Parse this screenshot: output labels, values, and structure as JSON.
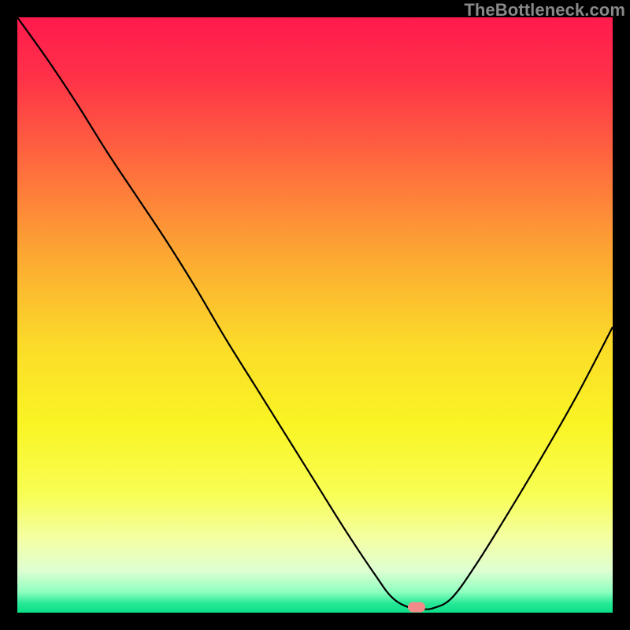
{
  "watermark": "TheBottleneck.com",
  "marker": {
    "color": "#F48A8A",
    "x_pct": 67.0,
    "y_pct": 99.1
  },
  "chart_data": {
    "type": "line",
    "title": "",
    "xlabel": "",
    "ylabel": "",
    "xlim": [
      0,
      100
    ],
    "ylim": [
      0,
      100
    ],
    "gradient_stops": [
      {
        "offset": 0.0,
        "color": "#FF1A4E"
      },
      {
        "offset": 0.1,
        "color": "#FF3148"
      },
      {
        "offset": 0.25,
        "color": "#FE6C3D"
      },
      {
        "offset": 0.4,
        "color": "#FCA832"
      },
      {
        "offset": 0.55,
        "color": "#FBDB29"
      },
      {
        "offset": 0.68,
        "color": "#FAF424"
      },
      {
        "offset": 0.8,
        "color": "#F8FE53"
      },
      {
        "offset": 0.88,
        "color": "#F3FFA8"
      },
      {
        "offset": 0.93,
        "color": "#DDFFD2"
      },
      {
        "offset": 0.965,
        "color": "#8FFFC0"
      },
      {
        "offset": 0.985,
        "color": "#25E895"
      },
      {
        "offset": 1.0,
        "color": "#0BDF87"
      }
    ],
    "series": [
      {
        "name": "bottleneck-curve",
        "color": "#000000",
        "x": [
          0.0,
          5.0,
          10.0,
          15.0,
          20.0,
          25.0,
          30.0,
          35.0,
          40.0,
          45.0,
          50.0,
          55.0,
          60.0,
          63.0,
          66.0,
          68.0,
          70.0,
          73.0,
          77.0,
          82.0,
          88.0,
          94.0,
          100.0
        ],
        "y": [
          100.0,
          93.0,
          85.5,
          77.5,
          70.0,
          62.5,
          54.5,
          46.0,
          38.0,
          30.0,
          22.0,
          14.0,
          6.5,
          2.5,
          0.8,
          0.6,
          0.8,
          2.5,
          8.0,
          16.0,
          26.0,
          36.5,
          48.0
        ]
      }
    ],
    "marker_point": {
      "x": 67.0,
      "y": 0.9
    }
  }
}
